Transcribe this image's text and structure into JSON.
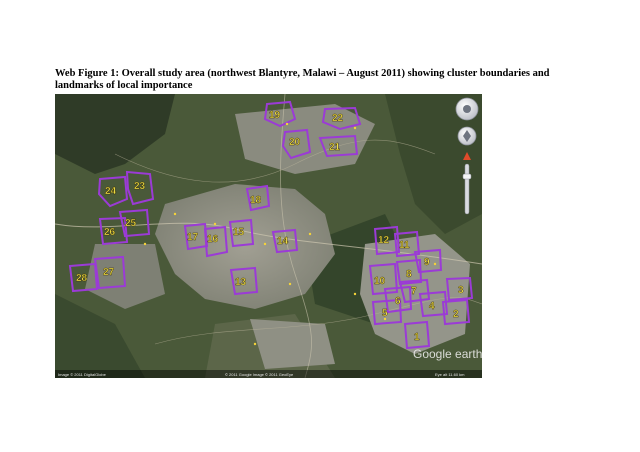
{
  "caption": {
    "line1": "Web Figure 1: Overall study area (northwest Blantyre, Malawi – August 2011) showing cluster boundaries and",
    "line2": "landmarks of local importance"
  },
  "map": {
    "watermark": "Google earth",
    "attribution_left": "Image © 2011 DigitalGlobe",
    "attribution_mid": "© 2011 Google  Image © 2011 GeoEye",
    "attribution_right": "Eye alt 11.60 km",
    "colors": {
      "boundary": "#9b3bd6",
      "label": "#f7e94a",
      "urban": "#8e8e86",
      "vegetation": "#3f5230"
    },
    "clusters": [
      {
        "id": "1",
        "label": "1"
      },
      {
        "id": "2",
        "label": "2"
      },
      {
        "id": "3",
        "label": "3"
      },
      {
        "id": "4",
        "label": "4"
      },
      {
        "id": "5",
        "label": "5"
      },
      {
        "id": "6",
        "label": "6"
      },
      {
        "id": "7",
        "label": "7"
      },
      {
        "id": "8",
        "label": "8"
      },
      {
        "id": "9",
        "label": "9"
      },
      {
        "id": "10",
        "label": "10"
      },
      {
        "id": "11",
        "label": "11"
      },
      {
        "id": "12",
        "label": "12"
      },
      {
        "id": "13",
        "label": "13"
      },
      {
        "id": "14",
        "label": "14"
      },
      {
        "id": "15",
        "label": "15"
      },
      {
        "id": "16",
        "label": "16"
      },
      {
        "id": "17",
        "label": "17"
      },
      {
        "id": "18",
        "label": "18"
      },
      {
        "id": "19",
        "label": "19"
      },
      {
        "id": "20",
        "label": "20"
      },
      {
        "id": "21",
        "label": "21"
      },
      {
        "id": "22",
        "label": "22"
      },
      {
        "id": "23",
        "label": "23"
      },
      {
        "id": "24",
        "label": "24"
      },
      {
        "id": "25",
        "label": "25"
      },
      {
        "id": "26",
        "label": "26"
      },
      {
        "id": "27",
        "label": "27"
      },
      {
        "id": "28",
        "label": "28"
      }
    ]
  }
}
